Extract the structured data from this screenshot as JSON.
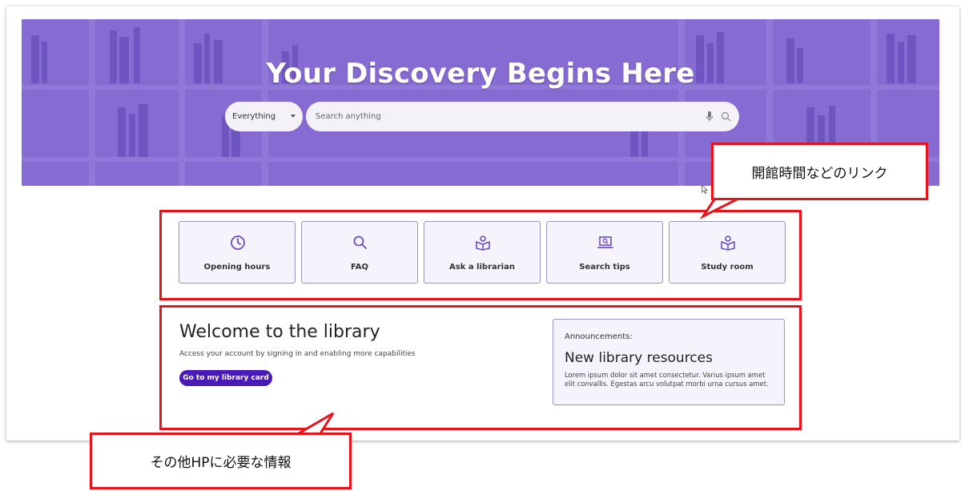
{
  "hero": {
    "title": "Your Discovery Begins Here",
    "scope_select": {
      "selected": "Everything"
    },
    "search": {
      "placeholder": "Search anything"
    }
  },
  "quick_links": [
    {
      "label": "Opening hours",
      "icon": "clock-icon"
    },
    {
      "label": "FAQ",
      "icon": "search-icon"
    },
    {
      "label": "Ask a librarian",
      "icon": "book-reader-icon"
    },
    {
      "label": "Search tips",
      "icon": "laptop-search-icon"
    },
    {
      "label": "Study room",
      "icon": "book-reader-icon"
    }
  ],
  "welcome": {
    "title": "Welcome to the library",
    "subtitle": "Access your account by signing in and enabling more capabilities",
    "button_label": "Go to my library card"
  },
  "announcements": {
    "heading": "Announcements:",
    "title": "New library resources",
    "body": "Lorem ipsum dolor sit amet consectetur. Varius ipsum amet elit convallis. Egestas arcu volutpat morbi urna cursus amet."
  },
  "annotations": {
    "links_callout": "開館時間などのリンク",
    "info_callout": "その他HPに必要な情報"
  },
  "colors": {
    "hero_purple": "#7b5fc4",
    "button_purple": "#4a1ab8",
    "icon_purple": "#6b4fc2",
    "annotation_red": "#e8141c"
  }
}
